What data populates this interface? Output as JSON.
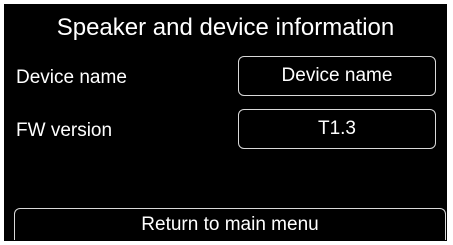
{
  "screen": {
    "title": "Speaker and device information",
    "background_color": "#000000",
    "text_color": "#ffffff"
  },
  "rows": [
    {
      "label": "Device name",
      "value": "Device name"
    },
    {
      "label": "FW version",
      "value": "T1.3"
    }
  ],
  "return_button": {
    "label": "Return to main menu"
  }
}
